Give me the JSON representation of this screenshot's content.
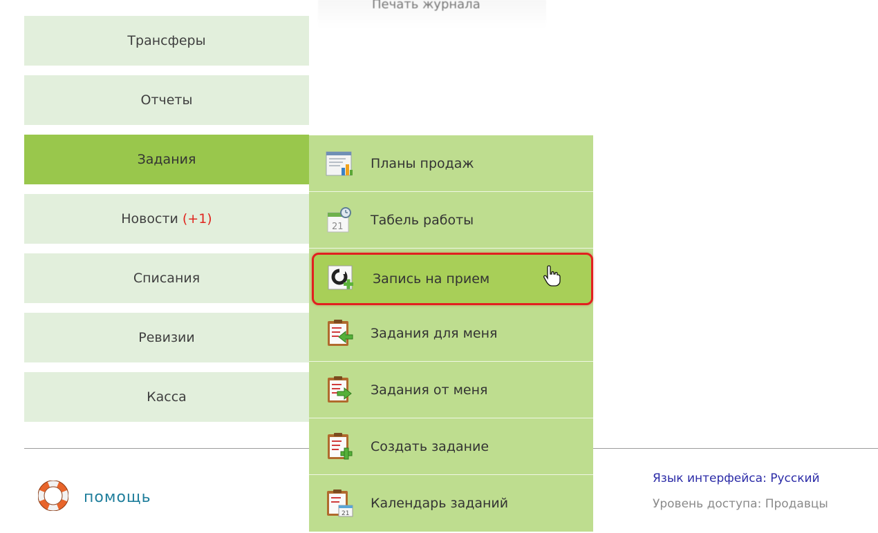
{
  "top_fragment_text": "Печать журнала",
  "nav": {
    "items": [
      {
        "label": "Трансферы"
      },
      {
        "label": "Отчеты"
      },
      {
        "label": "Задания"
      },
      {
        "label": "Новости",
        "badge": "(+1)"
      },
      {
        "label": "Списания"
      },
      {
        "label": "Ревизии"
      },
      {
        "label": "Касса"
      }
    ],
    "active_item": "Задания"
  },
  "submenu": {
    "items": [
      {
        "label": "Планы продаж",
        "icon": "sales-plan-icon"
      },
      {
        "label": "Табель работы",
        "icon": "timesheet-icon"
      },
      {
        "label": "Запись на прием",
        "icon": "appointment-icon"
      },
      {
        "label": "Задания для меня",
        "icon": "tasks-for-me-icon"
      },
      {
        "label": "Задания от меня",
        "icon": "tasks-from-me-icon"
      },
      {
        "label": "Создать задание",
        "icon": "create-task-icon"
      },
      {
        "label": "Календарь заданий",
        "icon": "task-calendar-icon"
      }
    ],
    "highlighted_item": "Запись на прием",
    "calendar_icon_day": "21"
  },
  "footer": {
    "help_label": "помощь",
    "language": "Язык интерфейса: Русский",
    "access_level": "Уровень доступа: Продавцы"
  },
  "colors": {
    "nav_bg": "#e2efdc",
    "nav_active_bg": "#99c74c",
    "submenu_bg": "#bedd8f",
    "highlight_border": "#e21f1f",
    "badge": "#e0251e",
    "help_text": "#1f7e9c",
    "language_link": "#2b2ba7"
  }
}
